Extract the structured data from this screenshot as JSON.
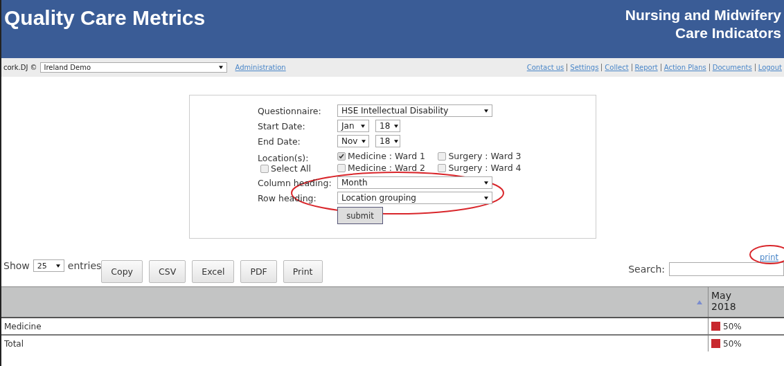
{
  "header": {
    "title": "Quality Care Metrics",
    "subtitle_lines": [
      "Nursing and Midwifery",
      "Care Indicators"
    ]
  },
  "toolbar": {
    "user": "cork.DJ ©",
    "organisation": "Ireland Demo",
    "admin_link": "Administration",
    "links": [
      "Contact us",
      "Settings",
      "Collect",
      "Report",
      "Action Plans",
      "Documents",
      "Logout"
    ]
  },
  "form": {
    "questionnaire_label": "Questionnaire:",
    "questionnaire": "HSE Intellectual Disability",
    "start_label": "Start Date:",
    "start_month": "Jan",
    "start_year": "18",
    "end_label": "End Date:",
    "end_month": "Nov",
    "end_year": "18",
    "locations_label": "Location(s):",
    "select_all": {
      "label": "Select All",
      "checked": false
    },
    "locations": [
      {
        "label": "Medicine : Ward 1",
        "checked": true
      },
      {
        "label": "Surgery : Ward 3",
        "checked": false
      },
      {
        "label": "Medicine : Ward 2",
        "checked": false
      },
      {
        "label": "Surgery : Ward 4",
        "checked": false
      }
    ],
    "column_heading_label": "Column heading:",
    "column_heading": "Month",
    "row_heading_label": "Row heading:",
    "row_heading": "Location grouping",
    "submit": "submit"
  },
  "table_controls": {
    "show_label": "Show",
    "page_size": "25",
    "entries_label": "entries",
    "buttons": [
      "Copy",
      "CSV",
      "Excel",
      "PDF",
      "Print"
    ],
    "print_link": "print",
    "search_label": "Search:"
  },
  "table": {
    "columns": [
      "May 2018"
    ],
    "rows": [
      {
        "label": "Medicine",
        "value": "50%",
        "color": "#c8282e"
      },
      {
        "label": "Total",
        "value": "50%",
        "color": "#c8282e"
      }
    ]
  }
}
